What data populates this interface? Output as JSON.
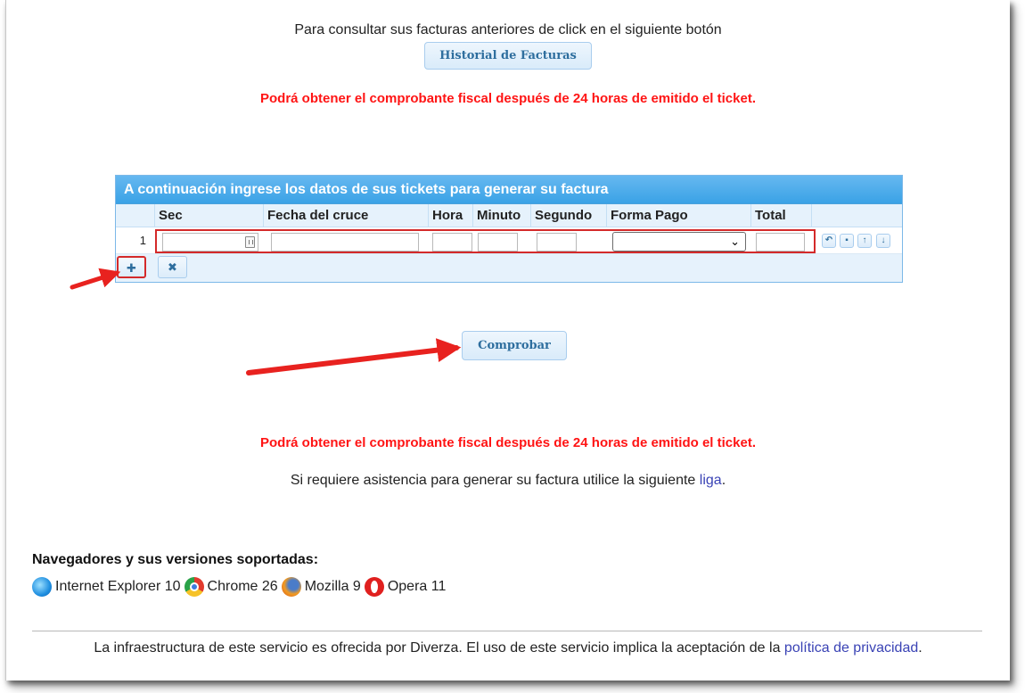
{
  "intro": {
    "text": "Para consultar sus facturas anteriores de click en el siguiente botón"
  },
  "historial_button": {
    "label": "Historial de Facturas"
  },
  "warning_text": "Podrá obtener el comprobante fiscal después de 24 horas de emitido el ticket.",
  "grid": {
    "caption": "A continuación ingrese los datos de sus tickets para generar su factura",
    "columns": [
      "Sec",
      "Fecha del cruce",
      "Hora",
      "Minuto",
      "Segundo",
      "Forma Pago",
      "Total"
    ],
    "rows": [
      {
        "row_number": "1",
        "sec": "",
        "fecha": "",
        "hora": "",
        "minuto": "",
        "segundo": "",
        "forma_pago": "",
        "total": ""
      }
    ],
    "row_actions": [
      "undo-icon",
      "trash-icon",
      "arrow-up-icon",
      "arrow-down-icon"
    ],
    "pager": {
      "add_icon": "plus-icon",
      "delete_icon": "x-icon"
    }
  },
  "comprobar_button": {
    "label": "Comprobar"
  },
  "assist": {
    "prefix": "Si requiere asistencia para generar su factura utilice la siguiente",
    "link": "liga",
    "suffix": "."
  },
  "browsers": {
    "title": "Navegadores y sus versiones soportadas:",
    "items": [
      {
        "icon": "internet-explorer-icon",
        "name": "Internet Explorer 10"
      },
      {
        "icon": "chrome-icon",
        "name": "Chrome 26"
      },
      {
        "icon": "firefox-icon",
        "name": "Mozilla 9"
      },
      {
        "icon": "opera-icon",
        "name": "Opera 11"
      }
    ]
  },
  "footer": {
    "text": "La infraestructura de este servicio es ofrecida por Diverza. El uso de este servicio implica la aceptación de la",
    "link": "política de privacidad",
    "suffix": "."
  },
  "colors": {
    "warning": "#ff1414",
    "grid_header": "#3aa2e6",
    "button_text": "#2e6e9e",
    "annotation_red": "#d42a2a",
    "link": "#3a43b5"
  }
}
